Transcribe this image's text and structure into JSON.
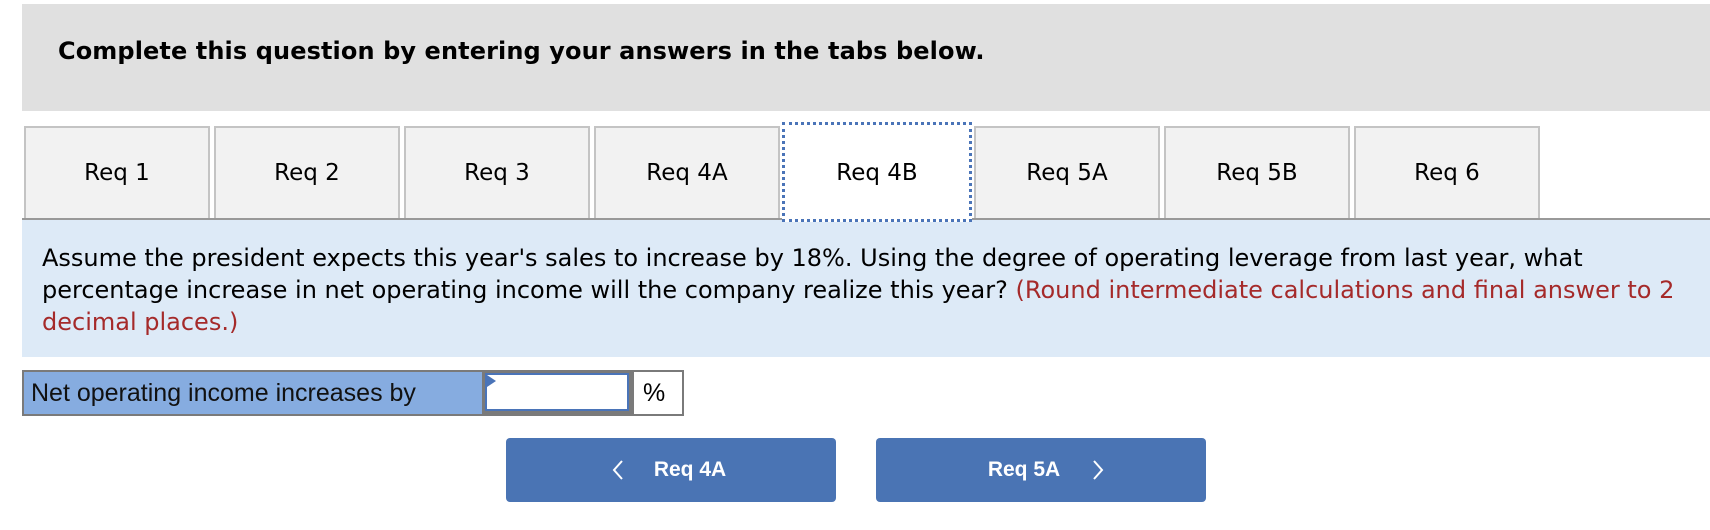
{
  "instruction": {
    "text": "Complete this question by entering your answers in the tabs below."
  },
  "tabs": [
    {
      "label": "Req 1",
      "active": false
    },
    {
      "label": "Req 2",
      "active": false
    },
    {
      "label": "Req 3",
      "active": false
    },
    {
      "label": "Req 4A",
      "active": false
    },
    {
      "label": "Req 4B",
      "active": true
    },
    {
      "label": "Req 5A",
      "active": false
    },
    {
      "label": "Req 5B",
      "active": false
    },
    {
      "label": "Req 6",
      "active": false
    }
  ],
  "question": {
    "text": "Assume the president expects this year's sales to increase by 18%. Using the degree of operating leverage from last year, what percentage increase in net operating income will the company realize this year?",
    "hint": "(Round intermediate calculations and final answer to 2 decimal places.)"
  },
  "answer": {
    "label": "Net operating income increases by",
    "value": "",
    "unit": "%"
  },
  "navigation": {
    "prev": {
      "label": "Req 4A",
      "icon": "chevron-left-icon"
    },
    "next": {
      "label": "Req 5A",
      "icon": "chevron-right-icon"
    }
  },
  "colors": {
    "banner_bg": "#e0e0e0",
    "question_bg": "#ddeaf7",
    "hint_text": "#a52a2a",
    "answer_label_bg": "#86ace0",
    "accent_blue": "#4a74b4",
    "tab_bg": "#f2f2f2"
  }
}
